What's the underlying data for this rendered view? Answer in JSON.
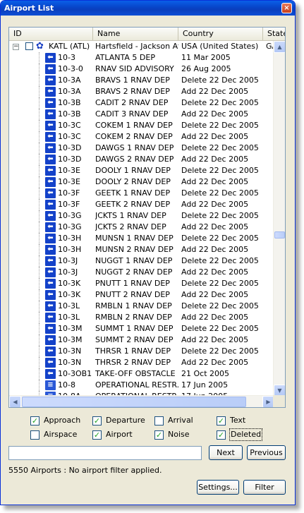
{
  "window": {
    "title": "Airport List",
    "close_glyph": "×"
  },
  "columns": [
    "ID",
    "Name",
    "Country",
    "State"
  ],
  "root": {
    "id": "KATL (ATL)",
    "name": "Hartsfield - Jackson At...",
    "country": "USA (United States)",
    "state": "GA",
    "expander": "−",
    "icon": "airport-gear-icon"
  },
  "rows": [
    {
      "id": "10-3",
      "name": "ATLANTA 5 DEP",
      "country": "11 Mar 2005",
      "icon": "departure-chart-icon"
    },
    {
      "id": "10-3-0",
      "name": "RNAV SID ADVISORY",
      "country": "26 Aug 2005",
      "icon": "departure-chart-icon"
    },
    {
      "id": "10-3A",
      "name": "BRAVS 1 RNAV DEP",
      "country": "Delete 22 Dec 2005",
      "icon": "departure-chart-icon"
    },
    {
      "id": "10-3A",
      "name": "BRAVS 2 RNAV DEP",
      "country": "Add 22 Dec 2005",
      "icon": "departure-chart-icon"
    },
    {
      "id": "10-3B",
      "name": "CADIT 2 RNAV DEP",
      "country": "Delete 22 Dec 2005",
      "icon": "departure-chart-icon"
    },
    {
      "id": "10-3B",
      "name": "CADIT 3 RNAV DEP",
      "country": "Add 22 Dec 2005",
      "icon": "departure-chart-icon"
    },
    {
      "id": "10-3C",
      "name": "COKEM 1 RNAV DEP",
      "country": "Delete 22 Dec 2005",
      "icon": "departure-chart-icon"
    },
    {
      "id": "10-3C",
      "name": "COKEM 2 RNAV DEP",
      "country": "Add 22 Dec 2005",
      "icon": "departure-chart-icon"
    },
    {
      "id": "10-3D",
      "name": "DAWGS 1 RNAV DEP",
      "country": "Delete 22 Dec 2005",
      "icon": "departure-chart-icon"
    },
    {
      "id": "10-3D",
      "name": "DAWGS 2 RNAV DEP",
      "country": "Add 22 Dec 2005",
      "icon": "departure-chart-icon"
    },
    {
      "id": "10-3E",
      "name": "DOOLY 1 RNAV DEP",
      "country": "Delete 22 Dec 2005",
      "icon": "departure-chart-icon"
    },
    {
      "id": "10-3E",
      "name": "DOOLY 2 RNAV DEP",
      "country": "Add 22 Dec 2005",
      "icon": "departure-chart-icon"
    },
    {
      "id": "10-3F",
      "name": "GEETK 1 RNAV DEP",
      "country": "Delete 22 Dec 2005",
      "icon": "departure-chart-icon"
    },
    {
      "id": "10-3F",
      "name": "GEETK 2 RNAV DEP",
      "country": "Add 22 Dec 2005",
      "icon": "departure-chart-icon"
    },
    {
      "id": "10-3G",
      "name": "JCKTS 1 RNAV DEP",
      "country": "Delete 22 Dec 2005",
      "icon": "departure-chart-icon"
    },
    {
      "id": "10-3G",
      "name": "JCKTS 2 RNAV DEP",
      "country": "Add 22 Dec 2005",
      "icon": "departure-chart-icon"
    },
    {
      "id": "10-3H",
      "name": "MUNSN 1 RNAV DEP",
      "country": "Delete 22 Dec 2005",
      "icon": "departure-chart-icon"
    },
    {
      "id": "10-3H",
      "name": "MUNSN 2 RNAV DEP",
      "country": "Add 22 Dec 2005",
      "icon": "departure-chart-icon"
    },
    {
      "id": "10-3J",
      "name": "NUGGT 1 RNAV DEP",
      "country": "Delete 22 Dec 2005",
      "icon": "departure-chart-icon"
    },
    {
      "id": "10-3J",
      "name": "NUGGT 2 RNAV DEP",
      "country": "Add 22 Dec 2005",
      "icon": "departure-chart-icon"
    },
    {
      "id": "10-3K",
      "name": "PNUTT 1 RNAV DEP",
      "country": "Delete 22 Dec 2005",
      "icon": "departure-chart-icon"
    },
    {
      "id": "10-3K",
      "name": "PNUTT 2 RNAV DEP",
      "country": "Add 22 Dec 2005",
      "icon": "departure-chart-icon"
    },
    {
      "id": "10-3L",
      "name": "RMBLN 1 RNAV DEP",
      "country": "Delete 22 Dec 2005",
      "icon": "departure-chart-icon"
    },
    {
      "id": "10-3L",
      "name": "RMBLN 2 RNAV DEP",
      "country": "Add 22 Dec 2005",
      "icon": "departure-chart-icon"
    },
    {
      "id": "10-3M",
      "name": "SUMMT 1 RNAV DEP",
      "country": "Delete 22 Dec 2005",
      "icon": "departure-chart-icon"
    },
    {
      "id": "10-3M",
      "name": "SUMMT 2 RNAV DEP",
      "country": "Add 22 Dec 2005",
      "icon": "departure-chart-icon"
    },
    {
      "id": "10-3N",
      "name": "THRSR 1 RNAV DEP",
      "country": "Delete 22 Dec 2005",
      "icon": "departure-chart-icon"
    },
    {
      "id": "10-3N",
      "name": "THRSR 2 RNAV DEP",
      "country": "Add 22 Dec 2005",
      "icon": "departure-chart-icon"
    },
    {
      "id": "10-3OB1",
      "name": "TAKE-OFF OBSTACLE ...",
      "country": "21 Oct 2005",
      "icon": "departure-chart-icon"
    },
    {
      "id": "10-8",
      "name": "OPERATIONAL RESTR...",
      "country": "17 Jun 2005",
      "icon": "text-chart-icon"
    },
    {
      "id": "10-8A",
      "name": "OPERATIONAL RESTR...",
      "country": "17 Jun 2005",
      "icon": "text-chart-icon"
    }
  ],
  "filters": [
    {
      "label": "Approach",
      "checked": true,
      "col": 0,
      "row": 0
    },
    {
      "label": "Departure",
      "checked": true,
      "col": 1,
      "row": 0
    },
    {
      "label": "Arrival",
      "checked": false,
      "col": 2,
      "row": 0
    },
    {
      "label": "Text",
      "checked": true,
      "col": 3,
      "row": 0
    },
    {
      "label": "Airspace",
      "checked": false,
      "col": 0,
      "row": 1
    },
    {
      "label": "Airport",
      "checked": true,
      "col": 1,
      "row": 1
    },
    {
      "label": "Noise",
      "checked": true,
      "col": 2,
      "row": 1
    },
    {
      "label": "Deleted",
      "checked": true,
      "col": 3,
      "row": 1,
      "focused": true
    }
  ],
  "search": {
    "value": "",
    "next_label": "Next",
    "previous_label": "Previous"
  },
  "status": "5550 Airports : No airport filter applied.",
  "buttons": {
    "settings_label": "Settings...",
    "filter_label": "Filter"
  },
  "glyphs": {
    "check": "✓",
    "up": "▲",
    "down": "▼",
    "left": "◀",
    "right": "▶",
    "airport_icon": "✿",
    "chart_icon": "⬅",
    "text_icon": "≡"
  }
}
